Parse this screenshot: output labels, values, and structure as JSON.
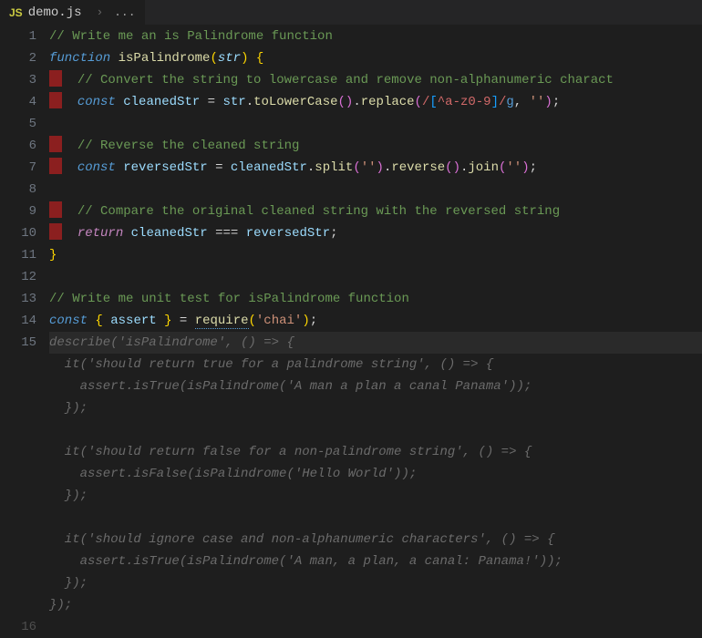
{
  "tab": {
    "icon_label": "JS",
    "filename": "demo.js",
    "breadcrumb_rest": "..."
  },
  "lines": [
    {
      "n": 1,
      "mark": false,
      "tokens": [
        [
          "c-comment",
          "// Write me an is Palindrome function"
        ]
      ]
    },
    {
      "n": 2,
      "mark": false,
      "tokens": [
        [
          "c-kw2",
          "function"
        ],
        [
          "",
          " "
        ],
        [
          "c-fn",
          "isPalindrome"
        ],
        [
          "c-brace",
          "("
        ],
        [
          "c-param",
          "str"
        ],
        [
          "c-brace",
          ")"
        ],
        [
          "",
          " "
        ],
        [
          "c-brace",
          "{"
        ]
      ]
    },
    {
      "n": 3,
      "mark": true,
      "tokens": [
        [
          "",
          "  "
        ],
        [
          "c-comment",
          "// Convert the string to lowercase and remove non-alphanumeric charact"
        ]
      ]
    },
    {
      "n": 4,
      "mark": true,
      "tokens": [
        [
          "",
          "  "
        ],
        [
          "c-kw2",
          "const"
        ],
        [
          "",
          " "
        ],
        [
          "c-var",
          "cleanedStr"
        ],
        [
          "",
          " "
        ],
        [
          "c-op",
          "="
        ],
        [
          "",
          " "
        ],
        [
          "c-var",
          "str"
        ],
        [
          "c-punc",
          "."
        ],
        [
          "c-fn",
          "toLowerCase"
        ],
        [
          "c-brace2",
          "("
        ],
        [
          "c-brace2",
          ")"
        ],
        [
          "c-punc",
          "."
        ],
        [
          "c-fn",
          "replace"
        ],
        [
          "c-brace2",
          "("
        ],
        [
          "c-regex",
          "/"
        ],
        [
          "c-brace3",
          "["
        ],
        [
          "c-regex",
          "^a-z0-9"
        ],
        [
          "c-brace3",
          "]"
        ],
        [
          "c-regex",
          "/"
        ],
        [
          "c-regexflag",
          "g"
        ],
        [
          "c-punc",
          ", "
        ],
        [
          "c-str",
          "''"
        ],
        [
          "c-brace2",
          ")"
        ],
        [
          "c-punc",
          ";"
        ]
      ]
    },
    {
      "n": 5,
      "mark": false,
      "tokens": []
    },
    {
      "n": 6,
      "mark": true,
      "tokens": [
        [
          "",
          "  "
        ],
        [
          "c-comment",
          "// Reverse the cleaned string"
        ]
      ]
    },
    {
      "n": 7,
      "mark": true,
      "tokens": [
        [
          "",
          "  "
        ],
        [
          "c-kw2",
          "const"
        ],
        [
          "",
          " "
        ],
        [
          "c-var",
          "reversedStr"
        ],
        [
          "",
          " "
        ],
        [
          "c-op",
          "="
        ],
        [
          "",
          " "
        ],
        [
          "c-var",
          "cleanedStr"
        ],
        [
          "c-punc",
          "."
        ],
        [
          "c-fn",
          "split"
        ],
        [
          "c-brace2",
          "("
        ],
        [
          "c-str",
          "''"
        ],
        [
          "c-brace2",
          ")"
        ],
        [
          "c-punc",
          "."
        ],
        [
          "c-fn",
          "reverse"
        ],
        [
          "c-brace2",
          "("
        ],
        [
          "c-brace2",
          ")"
        ],
        [
          "c-punc",
          "."
        ],
        [
          "c-fn",
          "join"
        ],
        [
          "c-brace2",
          "("
        ],
        [
          "c-str",
          "''"
        ],
        [
          "c-brace2",
          ")"
        ],
        [
          "c-punc",
          ";"
        ]
      ]
    },
    {
      "n": 8,
      "mark": false,
      "tokens": []
    },
    {
      "n": 9,
      "mark": true,
      "tokens": [
        [
          "",
          "  "
        ],
        [
          "c-comment",
          "// Compare the original cleaned string with the reversed string"
        ]
      ]
    },
    {
      "n": 10,
      "mark": true,
      "tokens": [
        [
          "",
          "  "
        ],
        [
          "c-kw",
          "return"
        ],
        [
          "",
          " "
        ],
        [
          "c-var",
          "cleanedStr"
        ],
        [
          "",
          " "
        ],
        [
          "c-op",
          "==="
        ],
        [
          "",
          " "
        ],
        [
          "c-var",
          "reversedStr"
        ],
        [
          "c-punc",
          ";"
        ]
      ]
    },
    {
      "n": 11,
      "mark": false,
      "tokens": [
        [
          "c-brace",
          "}"
        ]
      ]
    },
    {
      "n": 12,
      "mark": false,
      "tokens": []
    },
    {
      "n": 13,
      "mark": false,
      "tokens": [
        [
          "c-comment",
          "// Write me unit test for isPalindrome function"
        ]
      ]
    },
    {
      "n": 14,
      "mark": false,
      "tokens": [
        [
          "c-kw2",
          "const"
        ],
        [
          "",
          " "
        ],
        [
          "c-brace",
          "{"
        ],
        [
          "",
          " "
        ],
        [
          "c-var",
          "assert"
        ],
        [
          "",
          " "
        ],
        [
          "c-brace",
          "}"
        ],
        [
          "",
          " "
        ],
        [
          "c-op",
          "="
        ],
        [
          "",
          " "
        ],
        [
          "c-fn underline-dash",
          "require"
        ],
        [
          "c-brace",
          "("
        ],
        [
          "c-str",
          "'chai'"
        ],
        [
          "c-brace",
          ")"
        ],
        [
          "c-punc",
          ";"
        ]
      ]
    },
    {
      "n": 15,
      "mark": false,
      "current": true,
      "ghost": true,
      "tokens": [
        [
          "ghost",
          "describe('isPalindrome', () => {"
        ]
      ]
    },
    {
      "n": "",
      "ghost": true,
      "tokens": [
        [
          "ghost",
          "  it('should return true for a palindrome string', () => {"
        ]
      ]
    },
    {
      "n": "",
      "ghost": true,
      "tokens": [
        [
          "ghost",
          "    assert.isTrue(isPalindrome('A man a plan a canal Panama'));"
        ]
      ]
    },
    {
      "n": "",
      "ghost": true,
      "tokens": [
        [
          "ghost",
          "  });"
        ]
      ]
    },
    {
      "n": "",
      "ghost": true,
      "tokens": []
    },
    {
      "n": "",
      "ghost": true,
      "tokens": [
        [
          "ghost",
          "  it('should return false for a non-palindrome string', () => {"
        ]
      ]
    },
    {
      "n": "",
      "ghost": true,
      "tokens": [
        [
          "ghost",
          "    assert.isFalse(isPalindrome('Hello World'));"
        ]
      ]
    },
    {
      "n": "",
      "ghost": true,
      "tokens": [
        [
          "ghost",
          "  });"
        ]
      ]
    },
    {
      "n": "",
      "ghost": true,
      "tokens": []
    },
    {
      "n": "",
      "ghost": true,
      "tokens": [
        [
          "ghost",
          "  it('should ignore case and non-alphanumeric characters', () => {"
        ]
      ]
    },
    {
      "n": "",
      "ghost": true,
      "tokens": [
        [
          "ghost",
          "    assert.isTrue(isPalindrome('A man, a plan, a canal: Panama!'));"
        ]
      ]
    },
    {
      "n": "",
      "ghost": true,
      "tokens": [
        [
          "ghost",
          "  });"
        ]
      ]
    },
    {
      "n": "",
      "ghost": true,
      "tokens": [
        [
          "ghost",
          "});"
        ]
      ]
    },
    {
      "n": 16,
      "mark": false,
      "faint": true,
      "tokens": []
    }
  ]
}
